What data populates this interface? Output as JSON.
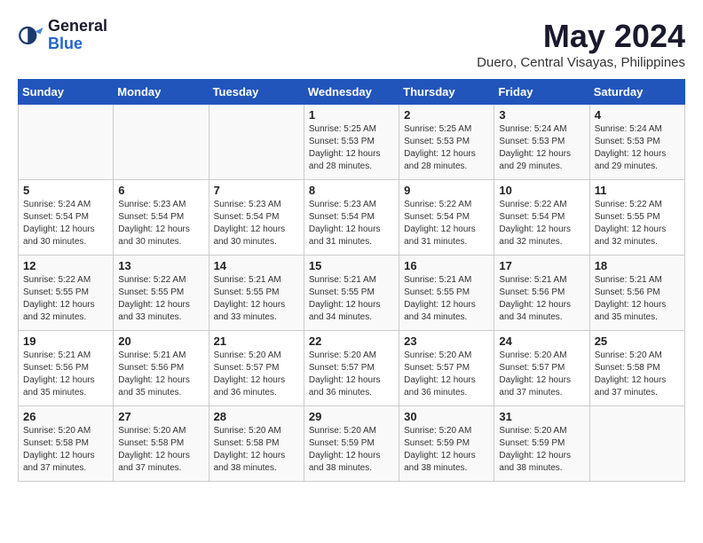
{
  "header": {
    "logo_line1": "General",
    "logo_line2": "Blue",
    "month": "May 2024",
    "location": "Duero, Central Visayas, Philippines"
  },
  "weekdays": [
    "Sunday",
    "Monday",
    "Tuesday",
    "Wednesday",
    "Thursday",
    "Friday",
    "Saturday"
  ],
  "weeks": [
    [
      {
        "day": "",
        "info": ""
      },
      {
        "day": "",
        "info": ""
      },
      {
        "day": "",
        "info": ""
      },
      {
        "day": "1",
        "info": "Sunrise: 5:25 AM\nSunset: 5:53 PM\nDaylight: 12 hours\nand 28 minutes."
      },
      {
        "day": "2",
        "info": "Sunrise: 5:25 AM\nSunset: 5:53 PM\nDaylight: 12 hours\nand 28 minutes."
      },
      {
        "day": "3",
        "info": "Sunrise: 5:24 AM\nSunset: 5:53 PM\nDaylight: 12 hours\nand 29 minutes."
      },
      {
        "day": "4",
        "info": "Sunrise: 5:24 AM\nSunset: 5:53 PM\nDaylight: 12 hours\nand 29 minutes."
      }
    ],
    [
      {
        "day": "5",
        "info": "Sunrise: 5:24 AM\nSunset: 5:54 PM\nDaylight: 12 hours\nand 30 minutes."
      },
      {
        "day": "6",
        "info": "Sunrise: 5:23 AM\nSunset: 5:54 PM\nDaylight: 12 hours\nand 30 minutes."
      },
      {
        "day": "7",
        "info": "Sunrise: 5:23 AM\nSunset: 5:54 PM\nDaylight: 12 hours\nand 30 minutes."
      },
      {
        "day": "8",
        "info": "Sunrise: 5:23 AM\nSunset: 5:54 PM\nDaylight: 12 hours\nand 31 minutes."
      },
      {
        "day": "9",
        "info": "Sunrise: 5:22 AM\nSunset: 5:54 PM\nDaylight: 12 hours\nand 31 minutes."
      },
      {
        "day": "10",
        "info": "Sunrise: 5:22 AM\nSunset: 5:54 PM\nDaylight: 12 hours\nand 32 minutes."
      },
      {
        "day": "11",
        "info": "Sunrise: 5:22 AM\nSunset: 5:55 PM\nDaylight: 12 hours\nand 32 minutes."
      }
    ],
    [
      {
        "day": "12",
        "info": "Sunrise: 5:22 AM\nSunset: 5:55 PM\nDaylight: 12 hours\nand 32 minutes."
      },
      {
        "day": "13",
        "info": "Sunrise: 5:22 AM\nSunset: 5:55 PM\nDaylight: 12 hours\nand 33 minutes."
      },
      {
        "day": "14",
        "info": "Sunrise: 5:21 AM\nSunset: 5:55 PM\nDaylight: 12 hours\nand 33 minutes."
      },
      {
        "day": "15",
        "info": "Sunrise: 5:21 AM\nSunset: 5:55 PM\nDaylight: 12 hours\nand 34 minutes."
      },
      {
        "day": "16",
        "info": "Sunrise: 5:21 AM\nSunset: 5:55 PM\nDaylight: 12 hours\nand 34 minutes."
      },
      {
        "day": "17",
        "info": "Sunrise: 5:21 AM\nSunset: 5:56 PM\nDaylight: 12 hours\nand 34 minutes."
      },
      {
        "day": "18",
        "info": "Sunrise: 5:21 AM\nSunset: 5:56 PM\nDaylight: 12 hours\nand 35 minutes."
      }
    ],
    [
      {
        "day": "19",
        "info": "Sunrise: 5:21 AM\nSunset: 5:56 PM\nDaylight: 12 hours\nand 35 minutes."
      },
      {
        "day": "20",
        "info": "Sunrise: 5:21 AM\nSunset: 5:56 PM\nDaylight: 12 hours\nand 35 minutes."
      },
      {
        "day": "21",
        "info": "Sunrise: 5:20 AM\nSunset: 5:57 PM\nDaylight: 12 hours\nand 36 minutes."
      },
      {
        "day": "22",
        "info": "Sunrise: 5:20 AM\nSunset: 5:57 PM\nDaylight: 12 hours\nand 36 minutes."
      },
      {
        "day": "23",
        "info": "Sunrise: 5:20 AM\nSunset: 5:57 PM\nDaylight: 12 hours\nand 36 minutes."
      },
      {
        "day": "24",
        "info": "Sunrise: 5:20 AM\nSunset: 5:57 PM\nDaylight: 12 hours\nand 37 minutes."
      },
      {
        "day": "25",
        "info": "Sunrise: 5:20 AM\nSunset: 5:58 PM\nDaylight: 12 hours\nand 37 minutes."
      }
    ],
    [
      {
        "day": "26",
        "info": "Sunrise: 5:20 AM\nSunset: 5:58 PM\nDaylight: 12 hours\nand 37 minutes."
      },
      {
        "day": "27",
        "info": "Sunrise: 5:20 AM\nSunset: 5:58 PM\nDaylight: 12 hours\nand 37 minutes."
      },
      {
        "day": "28",
        "info": "Sunrise: 5:20 AM\nSunset: 5:58 PM\nDaylight: 12 hours\nand 38 minutes."
      },
      {
        "day": "29",
        "info": "Sunrise: 5:20 AM\nSunset: 5:59 PM\nDaylight: 12 hours\nand 38 minutes."
      },
      {
        "day": "30",
        "info": "Sunrise: 5:20 AM\nSunset: 5:59 PM\nDaylight: 12 hours\nand 38 minutes."
      },
      {
        "day": "31",
        "info": "Sunrise: 5:20 AM\nSunset: 5:59 PM\nDaylight: 12 hours\nand 38 minutes."
      },
      {
        "day": "",
        "info": ""
      }
    ]
  ]
}
